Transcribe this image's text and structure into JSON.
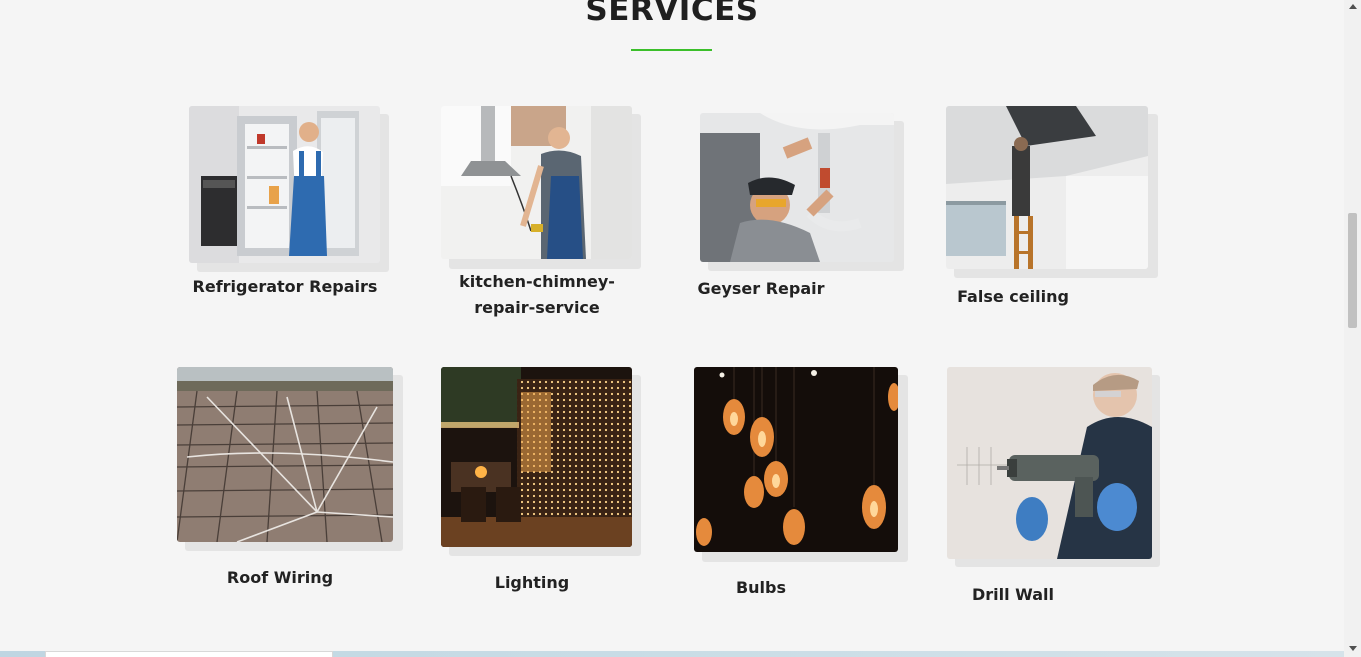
{
  "section": {
    "title": "SERVICES",
    "accent_color": "#3bbf2a"
  },
  "services": [
    {
      "label": "Refrigerator Repairs"
    },
    {
      "label": "kitchen-chimney-repair-service"
    },
    {
      "label": "Geyser Repair"
    },
    {
      "label": "False ceiling"
    },
    {
      "label": "Roof Wiring"
    },
    {
      "label": "Lighting"
    },
    {
      "label": "Bulbs"
    },
    {
      "label": "Drill Wall"
    }
  ]
}
